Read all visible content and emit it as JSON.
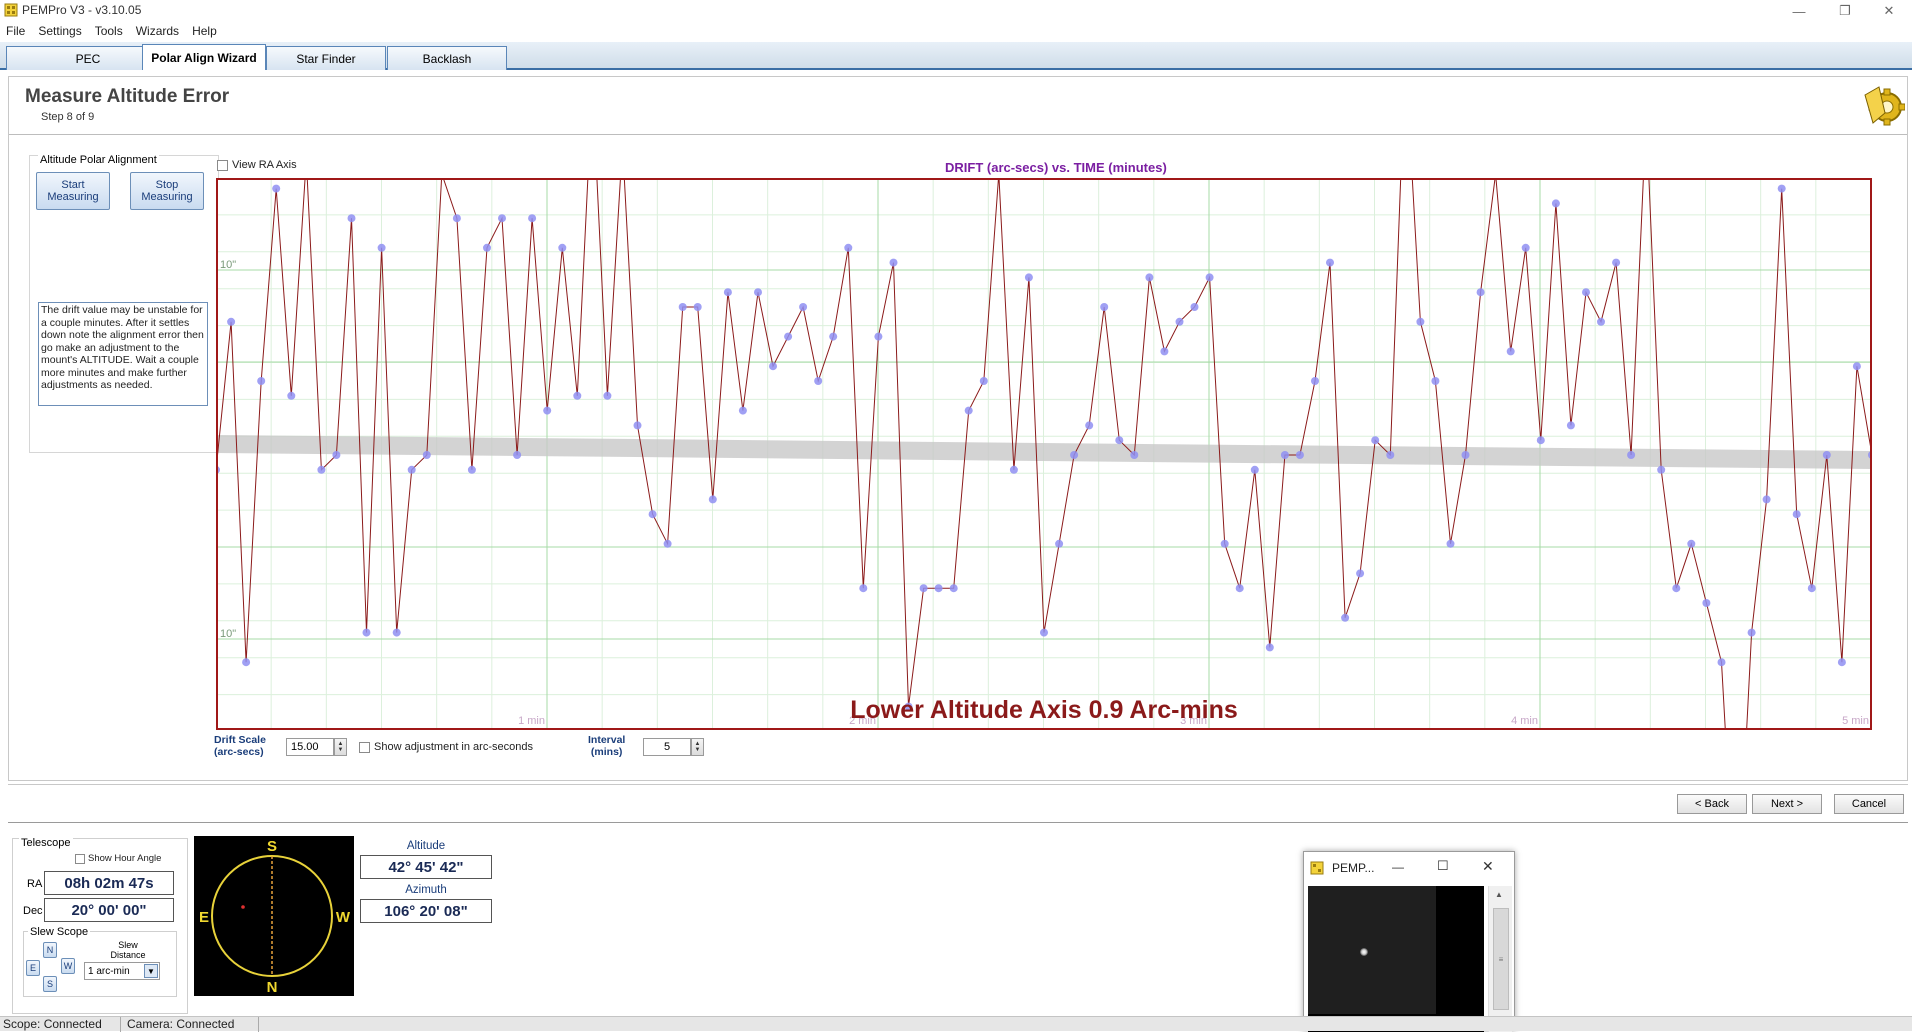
{
  "window": {
    "title": "PEMPro V3 - v3.10.05",
    "minimize_icon": "minimize-icon",
    "restore_icon": "restore-icon",
    "close_icon": "close-icon"
  },
  "menu": [
    "File",
    "Settings",
    "Tools",
    "Wizards",
    "Help"
  ],
  "tabs": [
    "PEC",
    "Polar Align Wizard",
    "Star Finder",
    "Backlash"
  ],
  "active_tab": "Polar Align Wizard",
  "page": {
    "title": "Measure Altitude Error",
    "step": "Step 8 of 9"
  },
  "altitude_group": {
    "legend": "Altitude Polar Alignment",
    "start_button": "Start Measuring",
    "stop_button": "Stop Measuring",
    "instructions": "The drift value may be unstable for a couple minutes. After it settles down note the alignment error then go make an adjustment to the mount's ALTITUDE. Wait a couple more minutes and make further adjustments as needed."
  },
  "view_ra_axis_label": "View RA Axis",
  "chart_data": {
    "type": "line",
    "title": "DRIFT (arc-secs) vs. TIME (minutes)",
    "y_tick_labels": [
      "10\"",
      "10\""
    ],
    "x_tick_labels": [
      "1 min",
      "2 min",
      "3 min",
      "4 min",
      "5 min"
    ],
    "xlim": [
      0,
      5
    ],
    "ylim": [
      -15,
      15
    ],
    "grid": true,
    "annotation": "Lower Altitude Axis 0.9 Arc-mins",
    "colors": {
      "line": "#8b1a1a",
      "point": "#8f8ff2",
      "trend_band": "#c8c8c8",
      "frame": "#a01818",
      "major_grid": "#a7dba7",
      "minor_grid": "#dcf0dc"
    },
    "series": [
      {
        "values": [
          -0.1,
          0.9,
          -1.4,
          0.5,
          1.8,
          0.4,
          2.0,
          -0.1,
          0.0,
          1.6,
          -1.2,
          1.4,
          -1.2,
          -0.1,
          0.0,
          1.9,
          1.6,
          -0.1,
          1.4,
          1.6,
          0.0,
          1.6,
          0.3,
          1.4,
          0.4,
          2.5,
          0.4,
          2.1,
          0.2,
          -0.4,
          -0.6,
          1.0,
          1.0,
          -0.3,
          1.1,
          0.3,
          1.1,
          0.6,
          0.8,
          1.0,
          0.5,
          0.8,
          1.4,
          -0.9,
          0.8,
          1.3,
          -1.7,
          -0.9,
          -0.9,
          -0.9,
          0.3,
          0.5,
          1.9,
          -0.1,
          1.2,
          -1.2,
          -0.6,
          0.0,
          0.2,
          1.0,
          0.1,
          0.0,
          1.2,
          0.7,
          0.9,
          1.0,
          1.2,
          -0.6,
          -0.9,
          -0.1,
          -1.3,
          0.0,
          0.0,
          0.5,
          1.3,
          -1.1,
          -0.8,
          0.1,
          0.0,
          2.7,
          0.9,
          0.5,
          -0.6,
          0.0,
          1.1,
          1.9,
          0.7,
          1.4,
          0.1,
          1.7,
          0.2,
          1.1,
          0.9,
          1.3,
          0.0,
          2.3,
          -0.1,
          -0.9,
          -0.6,
          -1.0,
          -1.4,
          -3.2,
          -1.2,
          -0.3,
          1.8,
          -0.4,
          -0.9,
          0.0,
          -1.4,
          0.6,
          0.0
        ]
      }
    ]
  },
  "drift_scale": {
    "label": "Drift Scale\n(arc-secs)",
    "value": "15.00"
  },
  "show_adjustment_label": "Show adjustment in arc-seconds",
  "interval": {
    "label": "Interval\n(mins)",
    "value": "5"
  },
  "nav": {
    "back": "< Back",
    "next": "Next >",
    "cancel": "Cancel"
  },
  "telescope": {
    "legend": "Telescope",
    "show_hour_angle": "Show Hour Angle",
    "ra_label": "RA",
    "ra_value": "08h 02m 47s",
    "dec_label": "Dec",
    "dec_value": "20° 00' 00\"",
    "slew_legend": "Slew Scope",
    "dir_n": "N",
    "dir_e": "E",
    "dir_w": "W",
    "dir_s": "S",
    "slew_distance_label": "Slew\nDistance",
    "slew_distance_value": "1 arc-min"
  },
  "compass": {
    "n": "N",
    "s": "S",
    "e": "E",
    "w": "W"
  },
  "altaz": {
    "altitude_label": "Altitude",
    "altitude_value": "42° 45' 42\"",
    "azimuth_label": "Azimuth",
    "azimuth_value": "106° 20' 08\""
  },
  "mini_window": {
    "title": "PEMP..."
  },
  "status": {
    "scope": "Scope: Connected",
    "camera": "Camera: Connected"
  }
}
